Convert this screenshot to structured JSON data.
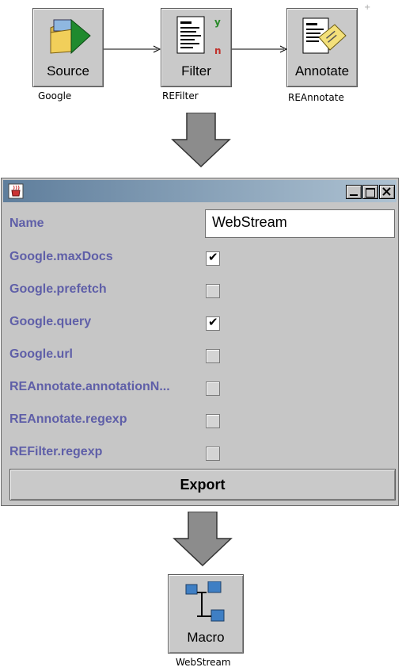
{
  "pipeline": {
    "nodes": [
      {
        "label": "Source",
        "sublabel": "Google",
        "icon": "folder-arrow-icon"
      },
      {
        "label": "Filter",
        "sublabel": "REFilter",
        "icon": "document-filter-icon",
        "flag_yes": "y",
        "flag_no": "n"
      },
      {
        "label": "Annotate",
        "sublabel": "REAnnotate",
        "icon": "document-note-icon"
      }
    ]
  },
  "dialog": {
    "window_controls": [
      "minimize",
      "maximize",
      "close"
    ],
    "name_label": "Name",
    "name_value": "WebStream",
    "properties": [
      {
        "label": "Google.maxDocs",
        "checked": true
      },
      {
        "label": "Google.prefetch",
        "checked": false
      },
      {
        "label": "Google.query",
        "checked": true
      },
      {
        "label": "Google.url",
        "checked": false
      },
      {
        "label": "REAnnotate.annotationN...",
        "checked": false
      },
      {
        "label": "REAnnotate.regexp",
        "checked": false
      },
      {
        "label": "REFilter.regexp",
        "checked": false
      }
    ],
    "export_label": "Export"
  },
  "result": {
    "label": "Macro",
    "sublabel": "WebStream",
    "icon": "macro-tree-icon"
  },
  "colors": {
    "label_text": "#5f5fa8",
    "panel": "#c6c6c6",
    "titlebar_start": "#5f7e9c",
    "titlebar_end": "#aec2d2"
  }
}
